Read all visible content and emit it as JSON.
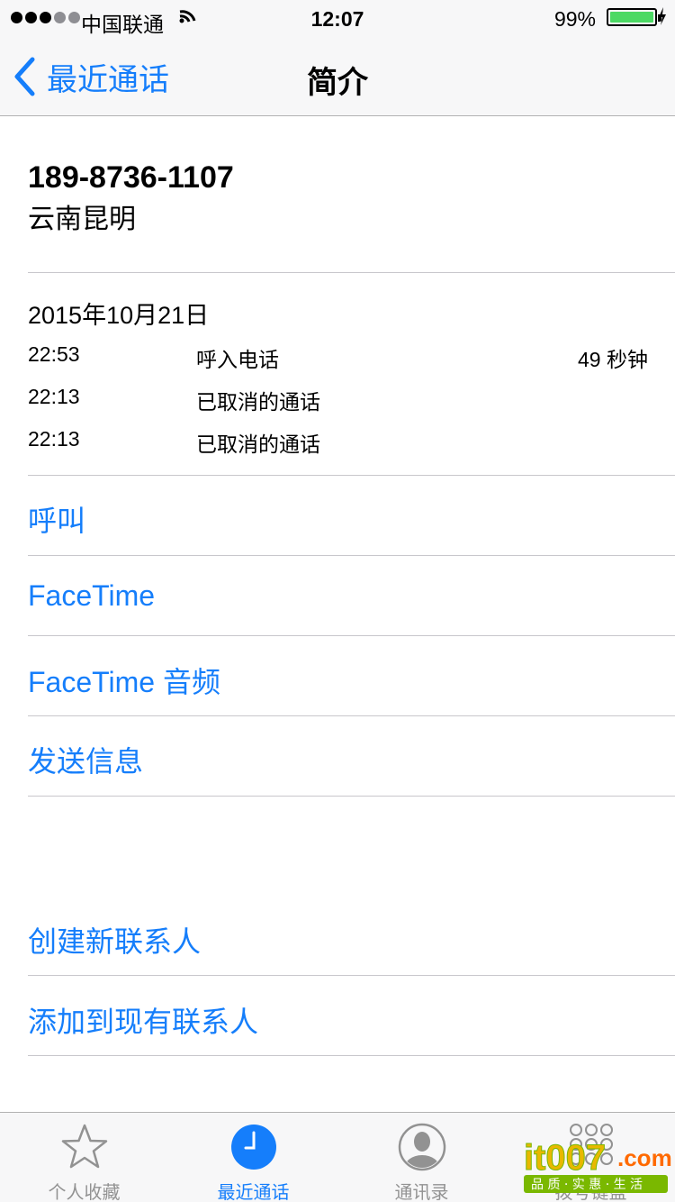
{
  "status_bar": {
    "carrier": "中国联通",
    "time": "12:07",
    "battery_percent": "99%",
    "battery_level": 0.99,
    "accent_battery": "#4cd964"
  },
  "nav": {
    "back_label": "最近通话",
    "title": "简介"
  },
  "contact": {
    "number": "189-8736-1107",
    "location": "云南昆明"
  },
  "history": {
    "date": "2015年10月21日",
    "calls": [
      {
        "time": "22:53",
        "type": "呼入电话",
        "duration": "49 秒钟"
      },
      {
        "time": "22:13",
        "type": "已取消的通话",
        "duration": ""
      },
      {
        "time": "22:13",
        "type": "已取消的通话",
        "duration": ""
      }
    ]
  },
  "actions": {
    "call": "呼叫",
    "facetime": "FaceTime",
    "facetime_audio": "FaceTime 音频",
    "message": "发送信息",
    "create_contact": "创建新联系人",
    "add_existing": "添加到现有联系人"
  },
  "tabs": [
    {
      "label": "个人收藏",
      "icon": "star-icon",
      "active": false
    },
    {
      "label": "最近通话",
      "icon": "clock-icon",
      "active": true
    },
    {
      "label": "通讯录",
      "icon": "contact-icon",
      "active": false
    },
    {
      "label": "拨号键盘",
      "icon": "keypad-icon",
      "active": false
    }
  ],
  "watermark": {
    "logo": "it007.com",
    "tagline": "品质·实惠·生活"
  },
  "colors": {
    "accent": "#157efb",
    "bar_background": "#f7f7f8",
    "separator": "#c8c7cc",
    "tab_inactive": "#929292"
  }
}
